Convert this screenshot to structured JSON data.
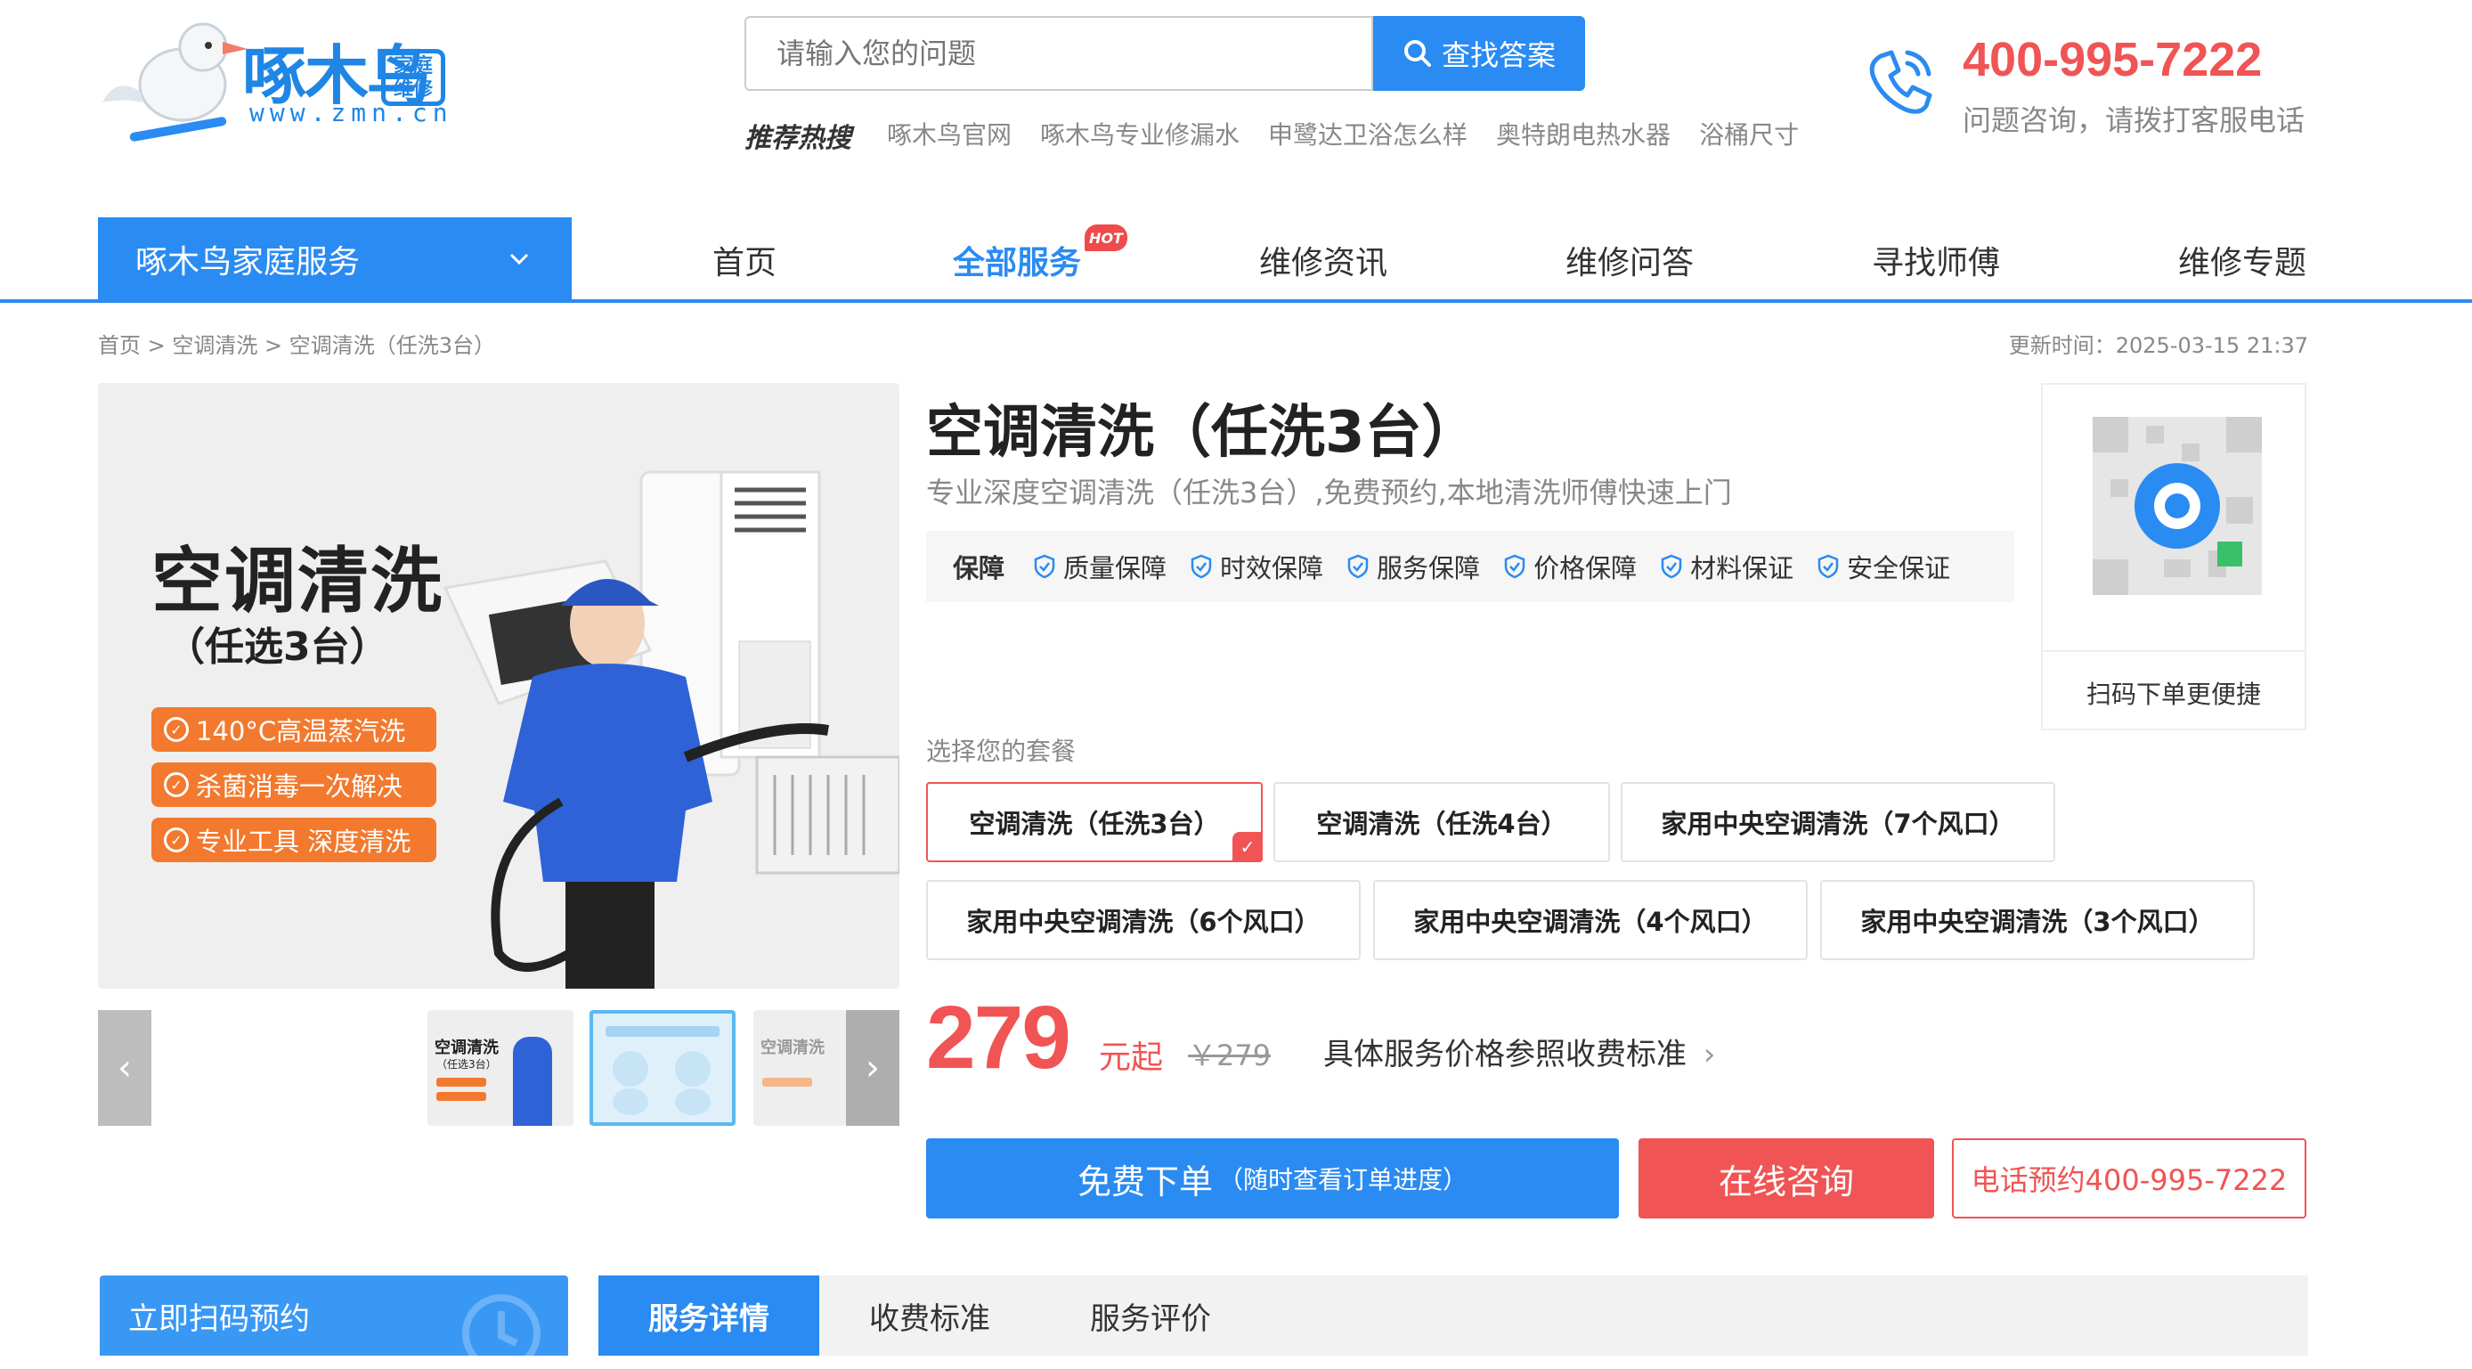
{
  "header": {
    "logo_text": "啄木鸟",
    "logo_badge": "家庭维修",
    "logo_url": "www.zmn.cn",
    "search_placeholder": "请输入您的问题",
    "search_button": "查找答案",
    "hot_label": "推荐热搜",
    "hot_links": [
      "啄木鸟官网",
      "啄木鸟专业修漏水",
      "申鹭达卫浴怎么样",
      "奥特朗电热水器",
      "浴桶尺寸"
    ],
    "phone": "400-995-7222",
    "phone_tip": "问题咨询，请拨打客服电话"
  },
  "nav": {
    "category": "啄木鸟家庭服务",
    "items": [
      "首页",
      "全部服务",
      "维修资讯",
      "维修问答",
      "寻找师傅",
      "维修专题"
    ],
    "hot_badge": "HOT"
  },
  "breadcrumb": "首页 > 空调清洗 > 空调清洗（任洗3台）",
  "updated": "更新时间：2025-03-15 21:37",
  "main_image": {
    "title": "空调清洗",
    "subtitle": "（任选3台）",
    "pills": [
      "140°C高温蒸汽洗",
      "杀菌消毒一次解决",
      "专业工具 深度清洗"
    ],
    "thumb_title": "空调清洗",
    "thumb_sub": "（任选3台）"
  },
  "product": {
    "title": "空调清洗（任洗3台）",
    "desc": "专业深度空调清洗（任洗3台）,免费预约,本地清洗师傅快速上门",
    "guarantee_label": "保障",
    "guarantees": [
      "质量保障",
      "时效保障",
      "服务保障",
      "价格保障",
      "材料保证",
      "安全保证"
    ],
    "qr_tip": "扫码下单更便捷",
    "package_label": "选择您的套餐",
    "packages": [
      "空调清洗（任洗3台）",
      "空调清洗（任洗4台）",
      "家用中央空调清洗（7个风口）",
      "家用中央空调清洗（6个风口）",
      "家用中央空调清洗（4个风口）",
      "家用中央空调清洗（3个风口）"
    ],
    "price": "279",
    "price_unit": "元起",
    "price_old": "￥279",
    "price_link": "具体服务价格参照收费标准",
    "btn_order": "免费下单",
    "btn_order_sub": "（随时查看订单进度）",
    "btn_consult": "在线咨询",
    "btn_phone": "电话预约400-995-7222"
  },
  "bottom": {
    "scan": "立即扫码预约",
    "tabs": [
      "服务详情",
      "收费标准",
      "服务评价"
    ]
  },
  "colors": {
    "primary": "#2a8bf2",
    "accent": "#f05454",
    "orange": "#f2792e"
  }
}
